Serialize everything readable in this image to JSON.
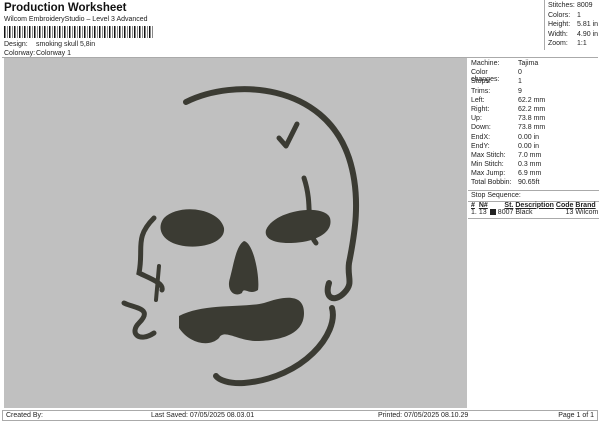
{
  "header": {
    "title": "Production Worksheet",
    "subtitle": "Wilcom EmbroideryStudio – Level 3 Advanced",
    "barcode_text": "Production Worksheet barcode",
    "design_label": "Design:",
    "design_value": "smoking skull 5,8in",
    "colorway_label": "Colorway:",
    "colorway_value": "Colorway 1"
  },
  "stats": [
    {
      "label": "Stitches:",
      "value": "8009"
    },
    {
      "label": "Colors:",
      "value": "1"
    },
    {
      "label": "Height:",
      "value": "5.81 in"
    },
    {
      "label": "Width:",
      "value": "4.90 in"
    },
    {
      "label": "Zoom:",
      "value": "1:1"
    }
  ],
  "machine": [
    {
      "label": "Machine:",
      "value": "Tajima"
    },
    {
      "label": "Color changes:",
      "value": "0"
    },
    {
      "label": "Stops:",
      "value": "1"
    },
    {
      "label": "Trims:",
      "value": "9"
    },
    {
      "label": "Left:",
      "value": "62.2 mm"
    },
    {
      "label": "Right:",
      "value": "62.2 mm"
    },
    {
      "label": "Up:",
      "value": "73.8 mm"
    },
    {
      "label": "Down:",
      "value": "73.8 mm"
    },
    {
      "label": "EndX:",
      "value": "0.00 in"
    },
    {
      "label": "EndY:",
      "value": "0.00 in"
    },
    {
      "label": "Max Stitch:",
      "value": "7.0 mm"
    },
    {
      "label": "Min Stitch:",
      "value": "0.3 mm"
    },
    {
      "label": "Max Jump:",
      "value": "6.9 mm"
    },
    {
      "label": "Total Bobbin:",
      "value": "90.65ft"
    }
  ],
  "stop_sequence": {
    "title": "Stop Sequence:",
    "headers": [
      "#",
      "N#",
      "St.",
      "Description",
      "Code",
      "Brand"
    ],
    "rows": [
      {
        "num": "1.",
        "n": "13",
        "st": "8007",
        "desc": "Black",
        "code": "13",
        "brand": "Wilcom",
        "swatch": "#222222"
      }
    ]
  },
  "footer": {
    "created": "Created By:",
    "saved": "Last Saved: 07/05/2025 08.03.01",
    "printed": "Printed: 07/05/2025 08.10.29",
    "page": "Page 1 of 1"
  },
  "colors": {
    "thread": "#3b3b33",
    "background": "#c0c0c0"
  }
}
